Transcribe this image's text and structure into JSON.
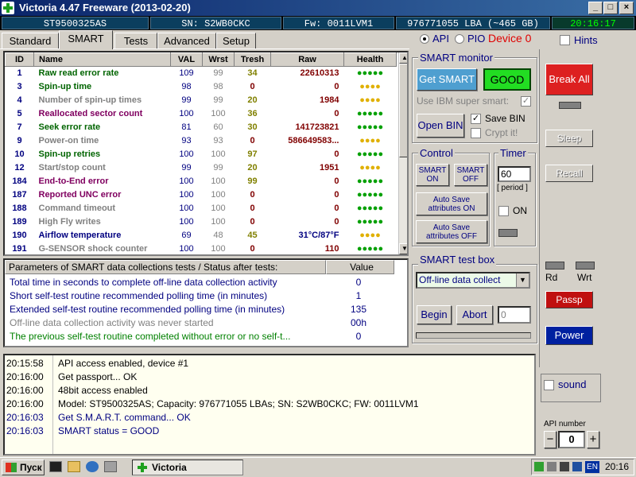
{
  "window": {
    "title": "Victoria 4.47  Freeware (2013-02-20)",
    "buttons": [
      "_",
      "□",
      "×"
    ]
  },
  "infobar": {
    "model": "ST9500325AS",
    "serial": "SN: S2WB0CKC",
    "firmware": "Fw: 0011LVM1",
    "lba": "976771055 LBA (~465 GB)",
    "time": "20:16:17"
  },
  "tabs": [
    "Standard",
    "SMART",
    "Tests",
    "Advanced",
    "Setup"
  ],
  "active_tab": "SMART",
  "mode": {
    "api_label": "API",
    "pio_label": "PIO",
    "device_label": "Device 0",
    "hints_label": "Hints"
  },
  "smart_table": {
    "columns": [
      "ID",
      "Name",
      "VAL",
      "Wrst",
      "Tresh",
      "Raw",
      "Health"
    ],
    "rows": [
      {
        "id": "1",
        "name": "Raw read error rate",
        "val": "109",
        "wrst": "99",
        "tresh": "34",
        "raw": "22610313",
        "health": "●●●●●",
        "name_color": "#006400",
        "raw_color": "#800000",
        "health_color": "#00a000",
        "tresh_color": "#808000"
      },
      {
        "id": "3",
        "name": "Spin-up time",
        "val": "98",
        "wrst": "98",
        "tresh": "0",
        "raw": "0",
        "health": "●●●●",
        "name_color": "#006400",
        "raw_color": "#800000",
        "health_color": "#e0b000",
        "tresh_color": "#800000"
      },
      {
        "id": "4",
        "name": "Number of spin-up times",
        "val": "99",
        "wrst": "99",
        "tresh": "20",
        "raw": "1984",
        "health": "●●●●",
        "name_color": "#808080",
        "raw_color": "#800000",
        "health_color": "#e0b000",
        "tresh_color": "#808000"
      },
      {
        "id": "5",
        "name": "Reallocated sector count",
        "val": "100",
        "wrst": "100",
        "tresh": "36",
        "raw": "0",
        "health": "●●●●●",
        "name_color": "#800060",
        "raw_color": "#800000",
        "health_color": "#00a000",
        "tresh_color": "#808000"
      },
      {
        "id": "7",
        "name": "Seek error rate",
        "val": "81",
        "wrst": "60",
        "tresh": "30",
        "raw": "141723821",
        "health": "●●●●●",
        "name_color": "#006400",
        "raw_color": "#800000",
        "health_color": "#00a000",
        "tresh_color": "#808000"
      },
      {
        "id": "9",
        "name": "Power-on time",
        "val": "93",
        "wrst": "93",
        "tresh": "0",
        "raw": "586649583...",
        "health": "●●●●",
        "name_color": "#808080",
        "raw_color": "#800000",
        "health_color": "#e0b000",
        "tresh_color": "#800000"
      },
      {
        "id": "10",
        "name": "Spin-up retries",
        "val": "100",
        "wrst": "100",
        "tresh": "97",
        "raw": "0",
        "health": "●●●●●",
        "name_color": "#006400",
        "raw_color": "#800000",
        "health_color": "#00a000",
        "tresh_color": "#808000"
      },
      {
        "id": "12",
        "name": "Start/stop count",
        "val": "99",
        "wrst": "99",
        "tresh": "20",
        "raw": "1951",
        "health": "●●●●",
        "name_color": "#808080",
        "raw_color": "#800000",
        "health_color": "#e0b000",
        "tresh_color": "#808000"
      },
      {
        "id": "184",
        "name": "End-to-End error",
        "val": "100",
        "wrst": "100",
        "tresh": "99",
        "raw": "0",
        "health": "●●●●●",
        "name_color": "#800060",
        "raw_color": "#800000",
        "health_color": "#00a000",
        "tresh_color": "#808000"
      },
      {
        "id": "187",
        "name": "Reported UNC error",
        "val": "100",
        "wrst": "100",
        "tresh": "0",
        "raw": "0",
        "health": "●●●●●",
        "name_color": "#800060",
        "raw_color": "#800000",
        "health_color": "#00a000",
        "tresh_color": "#800000"
      },
      {
        "id": "188",
        "name": "Command timeout",
        "val": "100",
        "wrst": "100",
        "tresh": "0",
        "raw": "0",
        "health": "●●●●●",
        "name_color": "#808080",
        "raw_color": "#800000",
        "health_color": "#00a000",
        "tresh_color": "#800000"
      },
      {
        "id": "189",
        "name": "High Fly writes",
        "val": "100",
        "wrst": "100",
        "tresh": "0",
        "raw": "0",
        "health": "●●●●●",
        "name_color": "#808080",
        "raw_color": "#800000",
        "health_color": "#00a000",
        "tresh_color": "#800000"
      },
      {
        "id": "190",
        "name": "Airflow temperature",
        "val": "69",
        "wrst": "48",
        "tresh": "45",
        "raw": "31°C/87°F",
        "health": "●●●●",
        "name_color": "#000080",
        "raw_color": "#000080",
        "health_color": "#e0b000",
        "tresh_color": "#808000"
      },
      {
        "id": "191",
        "name": "G-SENSOR shock counter",
        "val": "100",
        "wrst": "100",
        "tresh": "0",
        "raw": "110",
        "health": "●●●●●",
        "name_color": "#808080",
        "raw_color": "#800000",
        "health_color": "#00a000",
        "tresh_color": "#800000"
      }
    ]
  },
  "params": {
    "header": "Parameters of SMART data collections tests / Status after tests:",
    "value_header": "Value",
    "rows": [
      {
        "label": "Total time in seconds to complete off-line data collection activity",
        "value": "0",
        "color": "#000080"
      },
      {
        "label": "Short self-test routine recommended polling time (in minutes)",
        "value": "1",
        "color": "#000080"
      },
      {
        "label": "Extended self-test routine recommended polling time (in minutes)",
        "value": "135",
        "color": "#000080"
      },
      {
        "label": "Off-line data collection activity was never started",
        "value": "00h",
        "color": "#808080"
      },
      {
        "label": "The previous self-test routine completed without error or no self-t...",
        "value": "0",
        "color": "#008000"
      }
    ]
  },
  "log": [
    {
      "time": "20:15:58",
      "msg": "API access enabled, device #1",
      "color": "#000000"
    },
    {
      "time": "20:16:00",
      "msg": "Get passport... OK",
      "color": "#000000"
    },
    {
      "time": "20:16:00",
      "msg": "48bit access enabled",
      "color": "#000000"
    },
    {
      "time": "20:16:00",
      "msg": "Model: ST9500325AS; Capacity: 976771055 LBAs; SN: S2WB0CKC; FW: 0011LVM1",
      "color": "#000000"
    },
    {
      "time": "20:16:03",
      "msg": "Get S.M.A.R.T. command... OK",
      "color": "#000080"
    },
    {
      "time": "20:16:03",
      "msg": "SMART status = GOOD",
      "color": "#000080"
    }
  ],
  "smart_monitor": {
    "title": "SMART monitor",
    "get_smart": "Get SMART",
    "status": "GOOD",
    "ibm_label": "Use IBM super smart:",
    "open_bin": "Open BIN",
    "save_bin": "Save BIN",
    "crypt": "Crypt it!"
  },
  "control": {
    "title": "Control",
    "smart_on": "SMART ON",
    "smart_off": "SMART OFF",
    "autosave_on": "Auto Save attributes ON",
    "autosave_off": "Auto Save attributes OFF"
  },
  "timer": {
    "title": "Timer",
    "value": "60",
    "period": "[ period ]",
    "on_label": "ON"
  },
  "testbox": {
    "title": "SMART test box",
    "selected": "Off-line data collect",
    "begin": "Begin",
    "abort": "Abort",
    "value": "0"
  },
  "side": {
    "break_all": "Break All",
    "sleep": "Sleep",
    "recall": "Recall",
    "rd": "Rd",
    "wrt": "Wrt",
    "passp": "Passp",
    "power": "Power",
    "sound": "sound",
    "api_number_label": "API number",
    "api_number": "0"
  },
  "taskbar": {
    "start": "Пуск",
    "task": "Victoria",
    "lang": "EN",
    "clock": "20:16"
  },
  "colors": {
    "title_bar": "#0a246a",
    "good": "#22dd22",
    "break_all": "#dd2020",
    "passp": "#c01010",
    "power": "#0020a0",
    "device": "#e00000"
  }
}
